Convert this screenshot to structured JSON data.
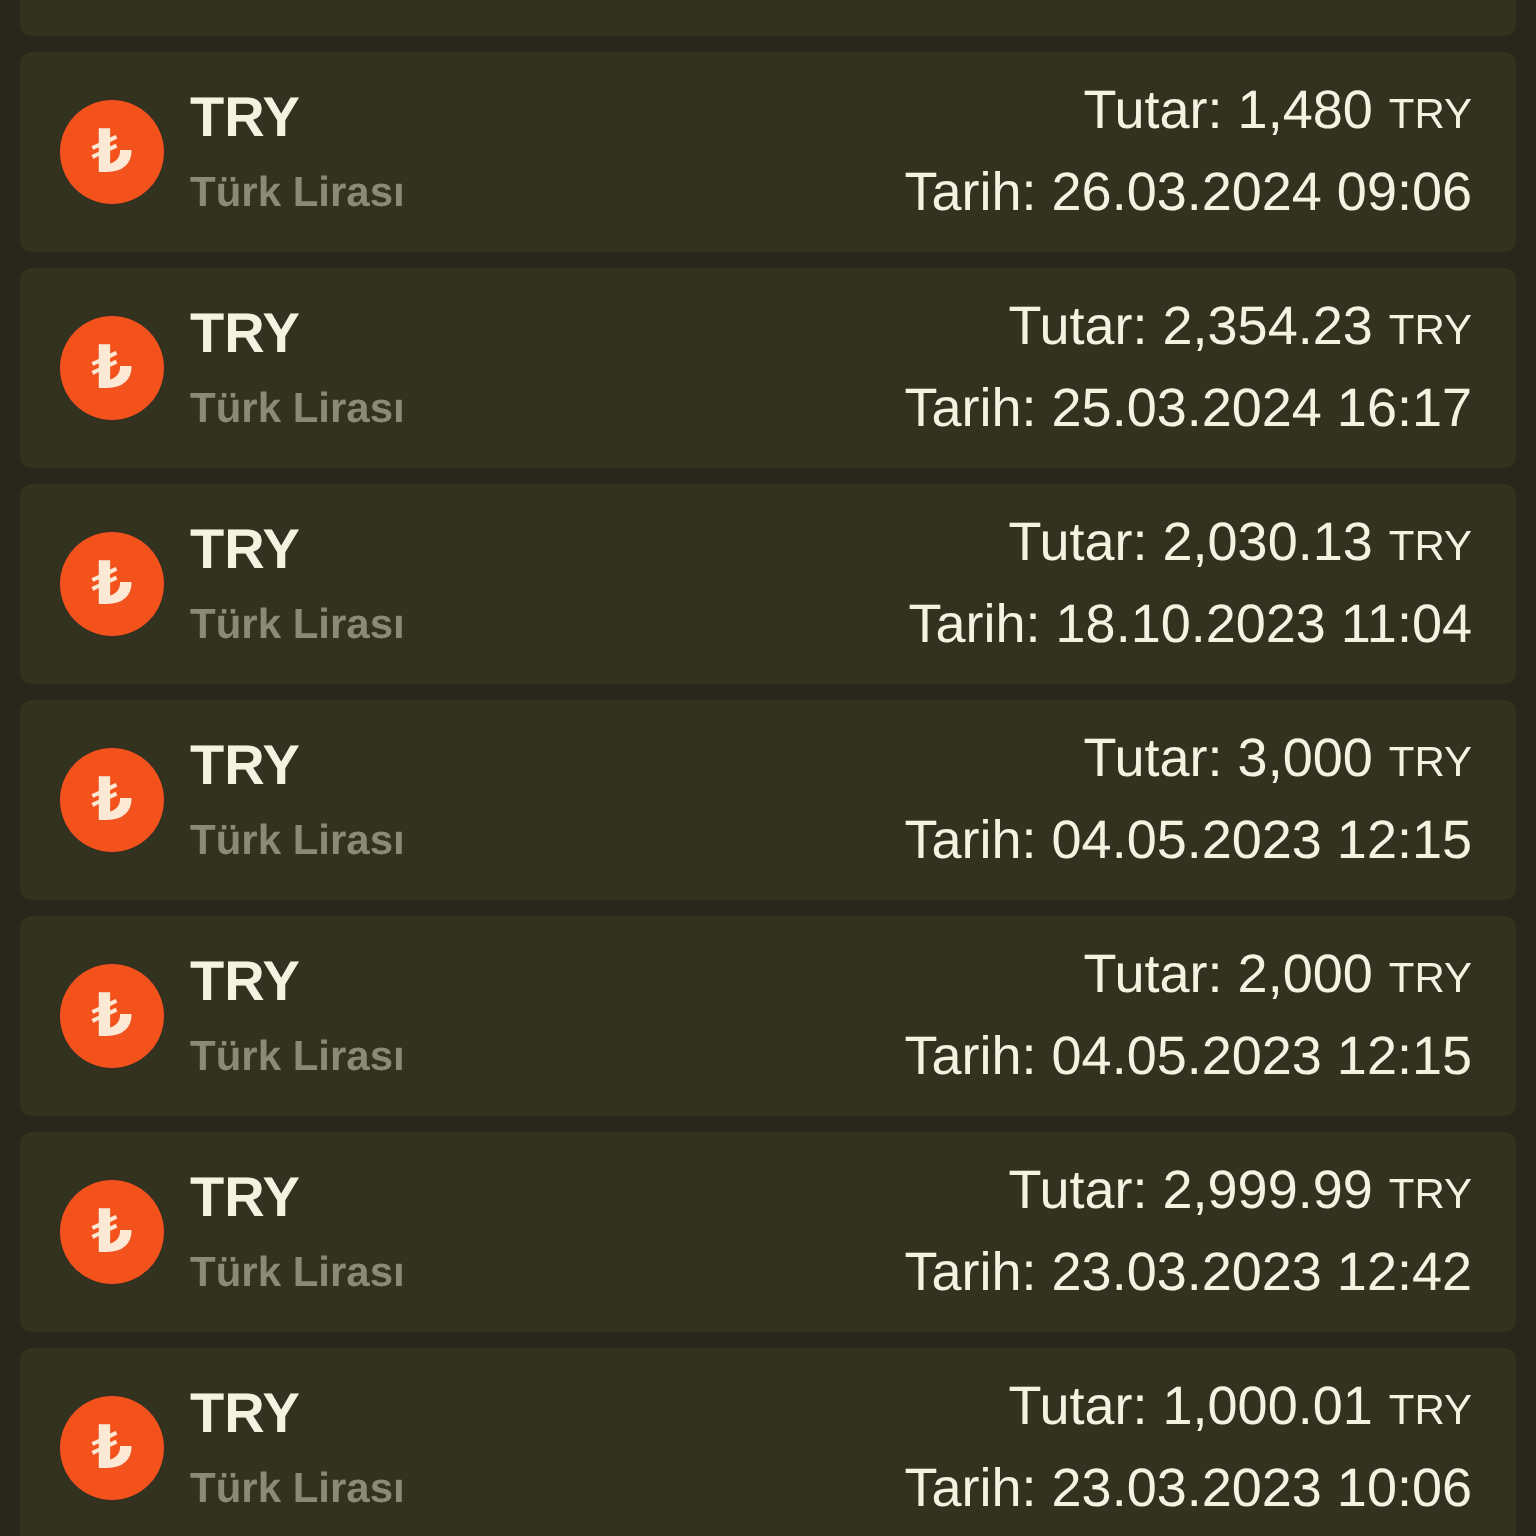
{
  "transactions": [
    {
      "symbol": "₺",
      "code": "TRY",
      "name": "Türk Lirası",
      "amount": "Tutar: 1,480",
      "currency": "TRY",
      "date": "Tarih: 26.03.2024 09:06"
    },
    {
      "symbol": "₺",
      "code": "TRY",
      "name": "Türk Lirası",
      "amount": "Tutar: 2,354.23",
      "currency": "TRY",
      "date": "Tarih: 25.03.2024 16:17"
    },
    {
      "symbol": "₺",
      "code": "TRY",
      "name": "Türk Lirası",
      "amount": "Tutar: 2,030.13",
      "currency": "TRY",
      "date": "Tarih: 18.10.2023 11:04"
    },
    {
      "symbol": "₺",
      "code": "TRY",
      "name": "Türk Lirası",
      "amount": "Tutar: 3,000",
      "currency": "TRY",
      "date": "Tarih: 04.05.2023 12:15"
    },
    {
      "symbol": "₺",
      "code": "TRY",
      "name": "Türk Lirası",
      "amount": "Tutar: 2,000",
      "currency": "TRY",
      "date": "Tarih: 04.05.2023 12:15"
    },
    {
      "symbol": "₺",
      "code": "TRY",
      "name": "Türk Lirası",
      "amount": "Tutar: 2,999.99",
      "currency": "TRY",
      "date": "Tarih: 23.03.2023 12:42"
    },
    {
      "symbol": "₺",
      "code": "TRY",
      "name": "Türk Lirası",
      "amount": "Tutar: 1,000.01",
      "currency": "TRY",
      "date": "Tarih: 23.03.2023 10:06"
    }
  ]
}
